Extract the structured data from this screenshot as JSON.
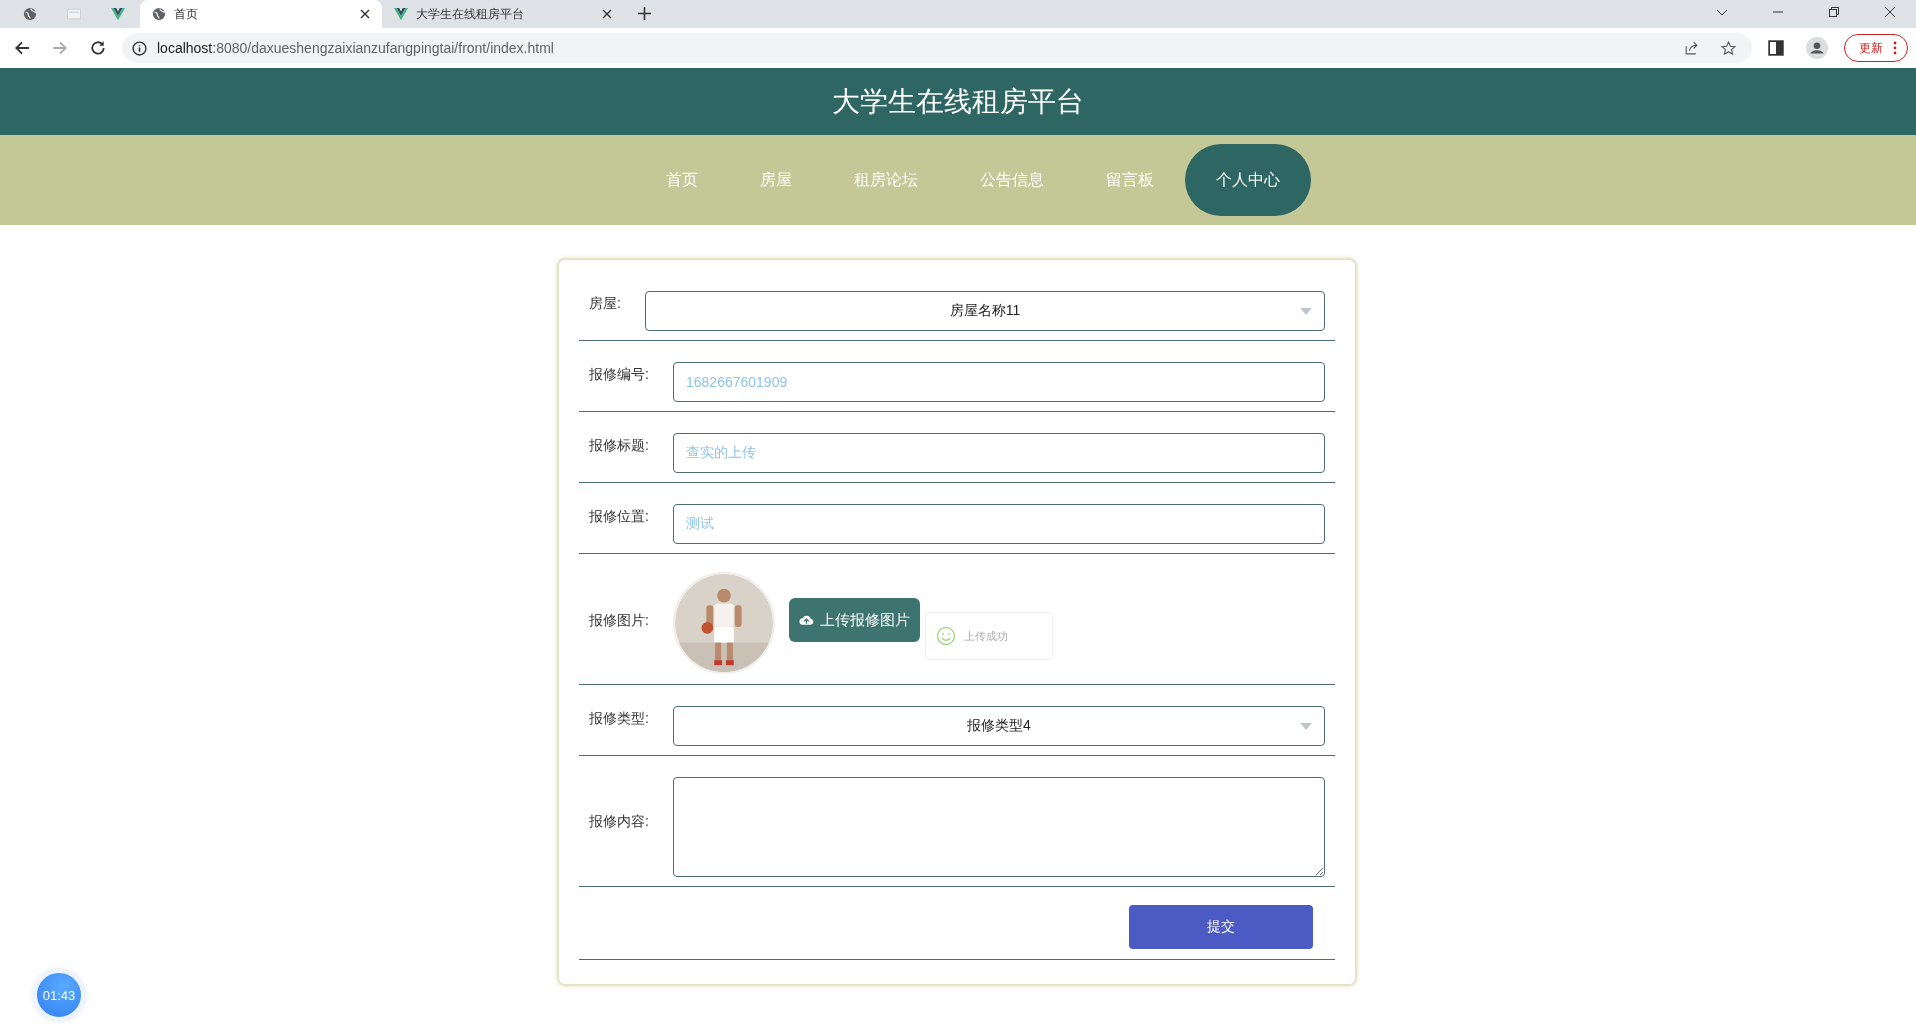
{
  "browser": {
    "tabs": [
      {
        "kind": "globe",
        "selected": false
      },
      {
        "kind": "page",
        "selected": false
      },
      {
        "kind": "vue",
        "selected": false
      },
      {
        "kind": "globe",
        "title": "首页",
        "selected": true
      },
      {
        "kind": "vue",
        "title": "大学生在线租房平台",
        "selected": false
      }
    ],
    "url_host": "localhost",
    "url_rest": ":8080/daxueshengzaixianzufangpingtai/front/index.html",
    "update_label": "更新"
  },
  "site_title": "大学生在线租房平台",
  "nav": [
    {
      "label": "首页",
      "selected": false
    },
    {
      "label": "房屋",
      "selected": false
    },
    {
      "label": "租房论坛",
      "selected": false
    },
    {
      "label": "公告信息",
      "selected": false
    },
    {
      "label": "留言板",
      "selected": false
    },
    {
      "label": "个人中心",
      "selected": true
    }
  ],
  "form": {
    "fields": [
      {
        "kind": "select",
        "label": "房屋:",
        "value": "房屋名称11"
      },
      {
        "kind": "input",
        "label": "报修编号:",
        "value": "1682667601909"
      },
      {
        "kind": "input",
        "label": "报修标题:",
        "value": "查实的上传"
      },
      {
        "kind": "input",
        "label": "报修位置:",
        "value": "测试"
      },
      {
        "label": "报修图片:",
        "button": "上传报修图片",
        "toast": "上传成功"
      },
      {
        "kind": "select",
        "label": "报修类型:",
        "value": "报修类型4"
      },
      {
        "kind": "textarea",
        "label": "报修内容:"
      }
    ],
    "submit": "提交"
  },
  "timer": "01:43"
}
